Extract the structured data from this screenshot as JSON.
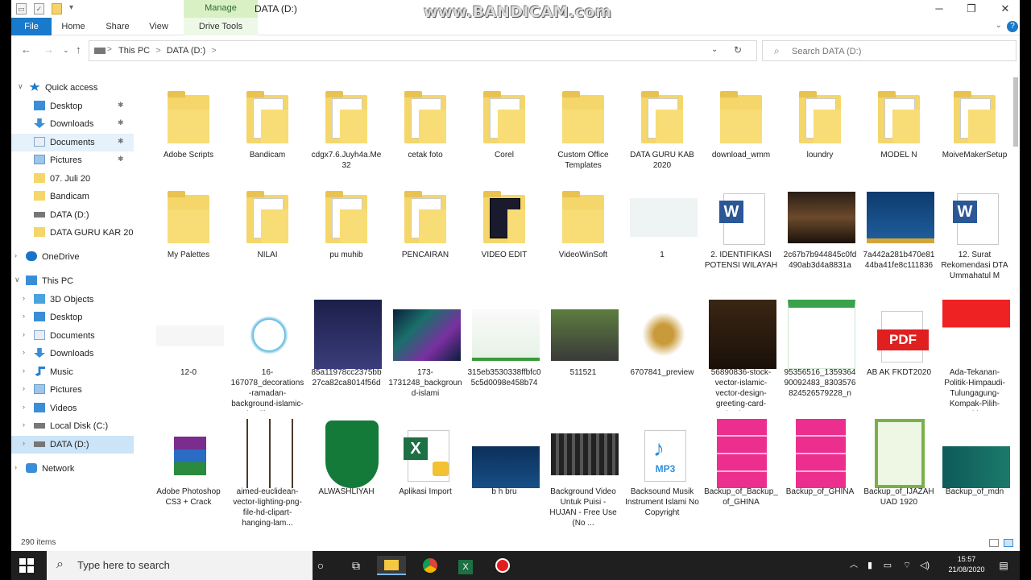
{
  "window": {
    "title": "DATA (D:)",
    "watermark": "www.BANDICAM.com",
    "manage_tab": "Manage",
    "minimize": "─",
    "maximize": "❐",
    "close": "✕"
  },
  "ribbon": {
    "tabs": [
      "File",
      "Home",
      "Share",
      "View",
      "Drive Tools"
    ],
    "help": "?"
  },
  "address": {
    "path_segments": [
      "This PC",
      "DATA (D:)"
    ],
    "separator": ">",
    "search_placeholder": "Search DATA (D:)"
  },
  "sidebar": {
    "items": [
      {
        "label": "Quick access",
        "icon": "star-icon",
        "pinned": false
      },
      {
        "label": "Desktop",
        "icon": "desktop-icon",
        "pinned": true
      },
      {
        "label": "Downloads",
        "icon": "download-icon",
        "pinned": true
      },
      {
        "label": "Documents",
        "icon": "documents-icon",
        "pinned": true
      },
      {
        "label": "Pictures",
        "icon": "pictures-icon",
        "pinned": true
      },
      {
        "label": "07. Juli 20",
        "icon": "folder-icon",
        "pinned": false
      },
      {
        "label": "Bandicam",
        "icon": "folder-icon",
        "pinned": false
      },
      {
        "label": "DATA (D:)",
        "icon": "drive-icon",
        "pinned": false
      },
      {
        "label": "DATA GURU KAR 20",
        "icon": "folder-icon",
        "pinned": false
      },
      {
        "label": "OneDrive",
        "icon": "cloud-icon",
        "pinned": false
      },
      {
        "label": "This PC",
        "icon": "computer-icon",
        "pinned": false
      },
      {
        "label": "3D Objects",
        "icon": "cube-icon",
        "pinned": false
      },
      {
        "label": "Desktop",
        "icon": "desktop-icon",
        "pinned": false
      },
      {
        "label": "Documents",
        "icon": "documents-icon",
        "pinned": false
      },
      {
        "label": "Downloads",
        "icon": "download-icon",
        "pinned": false
      },
      {
        "label": "Music",
        "icon": "music-icon",
        "pinned": false
      },
      {
        "label": "Pictures",
        "icon": "pictures-icon",
        "pinned": false
      },
      {
        "label": "Videos",
        "icon": "videos-icon",
        "pinned": false
      },
      {
        "label": "Local Disk (C:)",
        "icon": "drive-icon",
        "pinned": false
      },
      {
        "label": "DATA (D:)",
        "icon": "drive-icon",
        "pinned": false
      },
      {
        "label": "Network",
        "icon": "network-icon",
        "pinned": false
      }
    ]
  },
  "files": [
    {
      "name": "Adobe Scripts",
      "kind": "folder"
    },
    {
      "name": "Bandicam",
      "kind": "folder-docs"
    },
    {
      "name": "cdgx7.6.Juyh4a.Me32",
      "kind": "folder-docs"
    },
    {
      "name": "cetak foto",
      "kind": "folder-docs"
    },
    {
      "name": "Corel",
      "kind": "folder-docs"
    },
    {
      "name": "Custom Office Templates",
      "kind": "folder"
    },
    {
      "name": "DATA GURU KAB 2020",
      "kind": "folder-docs"
    },
    {
      "name": "download_wmm",
      "kind": "folder"
    },
    {
      "name": "loundry",
      "kind": "folder-docs"
    },
    {
      "name": "MODEL N",
      "kind": "folder-docs"
    },
    {
      "name": "MoiveMakerSetup",
      "kind": "folder-docs"
    },
    {
      "name": "My Palettes",
      "kind": "folder"
    },
    {
      "name": "NILAI",
      "kind": "folder-docs"
    },
    {
      "name": "pu muhib",
      "kind": "folder-docs"
    },
    {
      "name": "PENCAIRAN",
      "kind": "folder-docs"
    },
    {
      "name": "VIDEO EDIT",
      "kind": "folder-dark"
    },
    {
      "name": "VideoWinSoft",
      "kind": "folder"
    },
    {
      "name": "1",
      "kind": "image-light"
    },
    {
      "name": "2. IDENTIFIKASI POTENSI WILAYAH",
      "kind": "word"
    },
    {
      "name": "2c67b7b944845c0fd490ab3d4a8831a",
      "kind": "image-dark"
    },
    {
      "name": "7a442a281b470e8144ba41fe8c111836",
      "kind": "image-mosque"
    },
    {
      "name": "12. Surat Rekomendasi DTA Ummahatul M",
      "kind": "word"
    },
    {
      "name": "12-0",
      "kind": "image-calligraphy"
    },
    {
      "name": "16-167078_decorations-ramadan-background-islamic-jpg-library...",
      "kind": "image-ornament"
    },
    {
      "name": "85a11978cc2375bb27ca82ca8014f56d",
      "kind": "image-lantern-dark"
    },
    {
      "name": "173-1731248_background-islami",
      "kind": "image-colorful"
    },
    {
      "name": "315eb3530338ffbfc05c5d0098e458b74",
      "kind": "image-green-light"
    },
    {
      "name": "511521",
      "kind": "image-photo"
    },
    {
      "name": "6707841_preview",
      "kind": "image-lantern-gold"
    },
    {
      "name": "56890836-stock-vector-islamic-vector-design-greeting-card-backgr...",
      "kind": "image-arch"
    },
    {
      "name": "95356516_135936490092483_8303576824526579228_n",
      "kind": "image-green-doc"
    },
    {
      "name": "AB AK FKDT2020",
      "kind": "pdf"
    },
    {
      "name": "Ada-Tekanan-Politik-Himpaudi-Tulungagung-Kompak-Pilih-Nahk...",
      "kind": "image-himpaudi"
    },
    {
      "name": "Adobe Photoshop CS3 + Crack",
      "kind": "winrar"
    },
    {
      "name": "aimed-euclidean-vector-lighting-png-file-hd-clipart-hanging-lam...",
      "kind": "image-lamps"
    },
    {
      "name": "ALWASHLIYAH",
      "kind": "image-shield"
    },
    {
      "name": "Aplikasi Import",
      "kind": "excel"
    },
    {
      "name": "b h bru",
      "kind": "image-banner"
    },
    {
      "name": "Background Video Untuk Puisi - HUJAN - Free Use (No ...",
      "kind": "video"
    },
    {
      "name": "Backsound Musik Instrument Islami No Copyright",
      "kind": "mp3"
    },
    {
      "name": "Backup_of_Backup_of_GHINA",
      "kind": "image-pink"
    },
    {
      "name": "Backup_of_GHINA",
      "kind": "image-pink"
    },
    {
      "name": "Backup_of_IJAZAH UAD 1920",
      "kind": "image-certificate"
    },
    {
      "name": "Backup_of_mdn",
      "kind": "image-teal"
    }
  ],
  "status": {
    "item_count": "290 items"
  },
  "taskbar": {
    "search_placeholder": "Type here to search",
    "time": "15:57",
    "date": "21/08/2020"
  }
}
